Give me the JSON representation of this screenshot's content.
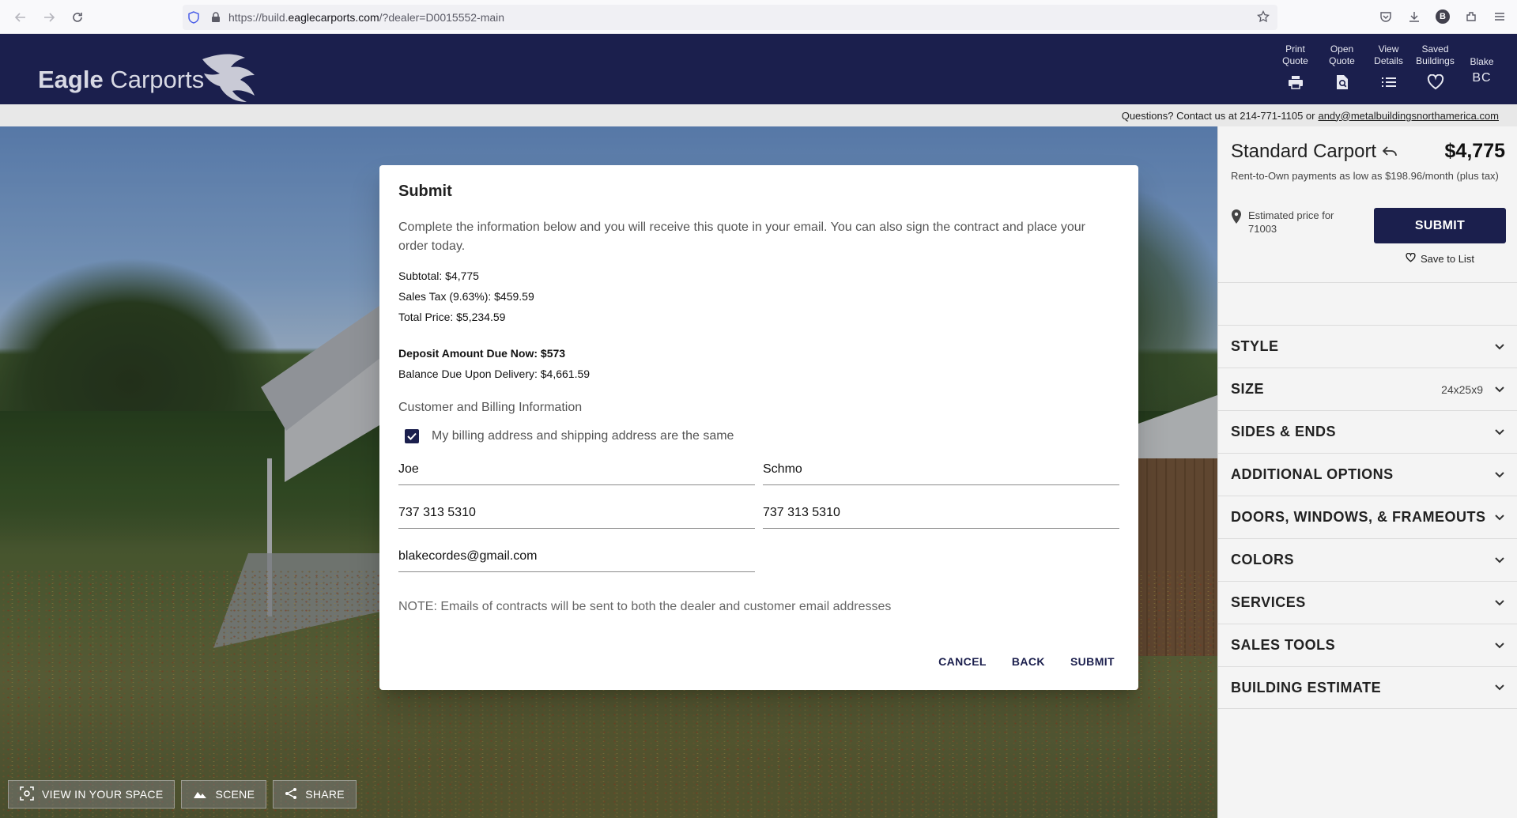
{
  "browser": {
    "url_prefix": "https://build.",
    "url_host": "eaglecarports.com",
    "url_path": "/?dealer=D0015552-main",
    "profile_initial": "B"
  },
  "header": {
    "logo_word1": "Eagle",
    "logo_word2": "Carports",
    "actions": [
      {
        "label_line1": "Print",
        "label_line2": "Quote",
        "icon": "printer-icon"
      },
      {
        "label_line1": "Open",
        "label_line2": "Quote",
        "icon": "open-document-icon"
      },
      {
        "label_line1": "View",
        "label_line2": "Details",
        "icon": "list-icon"
      },
      {
        "label_line1": "Saved",
        "label_line2": "Buildings",
        "icon": "heart-icon"
      }
    ],
    "user": {
      "name": "Blake",
      "initials": "BC"
    }
  },
  "contact": {
    "text": "Questions? Contact us at 214-771-1105 or",
    "email": "andy@metalbuildingsnorthamerica.com"
  },
  "scene_controls": {
    "view_in_space": "VIEW IN YOUR SPACE",
    "scene": "SCENE",
    "share": "SHARE"
  },
  "modal": {
    "title": "Submit",
    "intro": "Complete the information below and you will receive this quote in your email. You can also sign the contract and place your order today.",
    "subtotal": "Subtotal: $4,775",
    "sales_tax": "Sales Tax (9.63%): $459.59",
    "total": "Total Price: $5,234.59",
    "deposit": "Deposit Amount Due Now: $573",
    "balance": "Balance Due Upon Delivery: $4,661.59",
    "section_label": "Customer and Billing Information",
    "checkbox_label": "My billing address and shipping address are the same",
    "checkbox_checked": true,
    "fields": {
      "first_name": "Joe",
      "last_name": "Schmo",
      "phone": "737 313 5310",
      "phone2": "737 313 5310",
      "email": "blakecordes@gmail.com"
    },
    "note": "NOTE: Emails of contracts will be sent to both the dealer and customer email addresses",
    "buttons": {
      "cancel": "CANCEL",
      "back": "BACK",
      "submit": "SUBMIT"
    }
  },
  "panel": {
    "title": "Standard Carport",
    "price": "$4,775",
    "rto": "Rent-to-Own payments as low as $198.96/month (plus tax)",
    "estimate_line1": "Estimated price for",
    "estimate_line2": "71003",
    "submit": "SUBMIT",
    "save_to_list": "Save to List",
    "sections": [
      {
        "label": "STYLE",
        "extra": ""
      },
      {
        "label": "SIZE",
        "extra": "24x25x9"
      },
      {
        "label": "SIDES & ENDS",
        "extra": ""
      },
      {
        "label": "ADDITIONAL OPTIONS",
        "extra": ""
      },
      {
        "label": "DOORS, WINDOWS, & FRAMEOUTS",
        "extra": ""
      },
      {
        "label": "COLORS",
        "extra": ""
      },
      {
        "label": "SERVICES",
        "extra": ""
      },
      {
        "label": "SALES TOOLS",
        "extra": ""
      },
      {
        "label": "BUILDING ESTIMATE",
        "extra": ""
      }
    ]
  },
  "colors": {
    "brand_navy": "#1b1f4d"
  }
}
